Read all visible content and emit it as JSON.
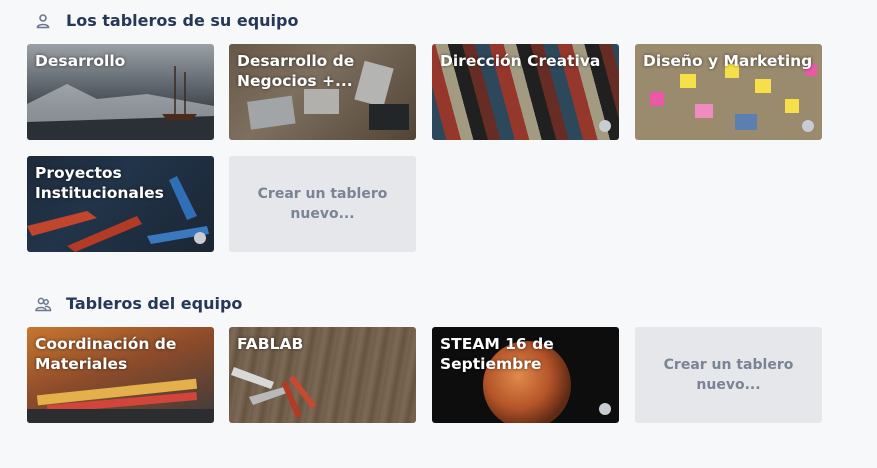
{
  "sections": [
    {
      "title": "Los tableros de su equipo",
      "icon": "person-icon",
      "boards": [
        {
          "label": "Desarrollo",
          "starred": false
        },
        {
          "label": "Desarrollo de Negocios +...",
          "starred": false
        },
        {
          "label": "Dirección Creativa",
          "starred": true
        },
        {
          "label": "Diseño y Marketing",
          "starred": true
        },
        {
          "label": "Proyectos Institucionales",
          "starred": true
        }
      ],
      "create_label": "Crear un tablero nuevo..."
    },
    {
      "title": "Tableros del equipo",
      "icon": "team-icon",
      "boards": [
        {
          "label": "Coordinación de Materiales",
          "starred": false
        },
        {
          "label": "FABLAB",
          "starred": false
        },
        {
          "label": "STEAM 16 de Septiembre",
          "starred": true
        }
      ],
      "create_label": "Crear un tablero nuevo..."
    }
  ]
}
